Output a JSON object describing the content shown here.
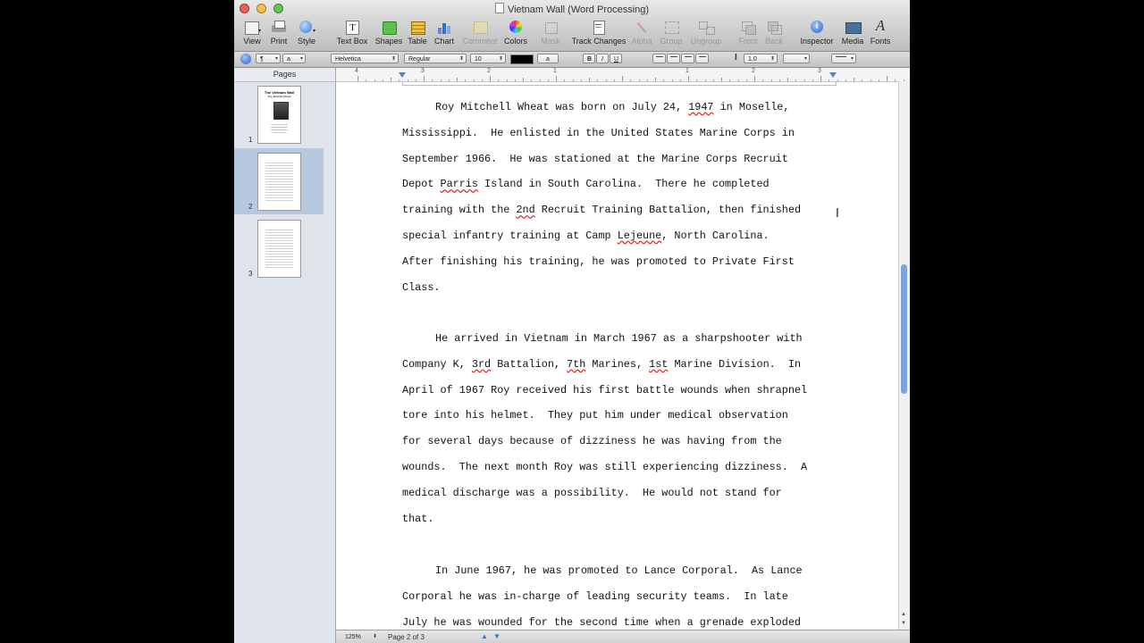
{
  "window": {
    "title": "Vietnam Wall (Word Processing)",
    "traffic_lights": [
      "#ec5f5a",
      "#f4be4f",
      "#62c655"
    ]
  },
  "toolbar": {
    "view": "View",
    "print": "Print",
    "style": "Style",
    "text_box": "Text Box",
    "shapes": "Shapes",
    "table": "Table",
    "chart": "Chart",
    "comment": "Comment",
    "colors": "Colors",
    "mask": "Mask",
    "track_changes": "Track Changes",
    "alpha": "Alpha",
    "group": "Group",
    "ungroup": "Ungroup",
    "front": "Front",
    "back": "Back",
    "inspector": "Inspector",
    "media": "Media",
    "fonts": "Fonts"
  },
  "format_bar": {
    "paragraph_style": "¶",
    "char_style": "a",
    "font_family": "Helvetica",
    "font_typeface": "Regular",
    "font_size": "10",
    "text_color": "#000000",
    "highlight_label": "a",
    "bold": "B",
    "italic": "I",
    "underline": "U",
    "line_spacing_icon": "I",
    "line_spacing": "1.0"
  },
  "sidebar": {
    "header": "Pages",
    "thumbnails": [
      {
        "number": "1",
        "title_lines": [
          "The Vietnam Wall",
          "Roy Mitchell Wheat"
        ]
      },
      {
        "number": "2"
      },
      {
        "number": "3"
      }
    ]
  },
  "ruler": {
    "labels": [
      "4",
      "3",
      "2",
      "1",
      "1",
      "2",
      "3"
    ]
  },
  "document": {
    "paragraphs": [
      {
        "lines": [
          [
            {
              "t": "Roy Mitchell Wheat was born on July 24, "
            },
            {
              "t": "1947",
              "sq": true
            },
            {
              "t": " in Moselle,"
            }
          ],
          [
            {
              "t": "Mississippi.  He enlisted in the United States Marine Corps in"
            }
          ],
          [
            {
              "t": "September 1966.  He was stationed at the Marine Corps Recruit"
            }
          ],
          [
            {
              "t": "Depot "
            },
            {
              "t": "Parris",
              "sq": true
            },
            {
              "t": " Island in South Carolina.  There he completed"
            }
          ],
          [
            {
              "t": "training with the "
            },
            {
              "t": "2nd",
              "sq": true
            },
            {
              "t": " Recruit Training Battalion, then finished"
            }
          ],
          [
            {
              "t": "special infantry training at Camp "
            },
            {
              "t": "Lejeune",
              "sq": true
            },
            {
              "t": ", North Carolina."
            }
          ],
          [
            {
              "t": "After finishing his training, he was promoted to Private First"
            }
          ],
          [
            {
              "t": "Class."
            }
          ]
        ]
      },
      {
        "lines": [
          [
            {
              "t": "He arrived in Vietnam in March 1967 as a sharpshooter with"
            }
          ],
          [
            {
              "t": "Company K, "
            },
            {
              "t": "3rd",
              "sq": true
            },
            {
              "t": " Battalion, "
            },
            {
              "t": "7th",
              "sq": true
            },
            {
              "t": " Marines, "
            },
            {
              "t": "1st",
              "sq": true
            },
            {
              "t": " Marine Division.  In"
            }
          ],
          [
            {
              "t": "April of 1967 Roy received his first battle wounds when shrapnel"
            }
          ],
          [
            {
              "t": "tore into his helmet.  They put him under medical observation"
            }
          ],
          [
            {
              "t": "for several days because of dizziness he was having from the"
            }
          ],
          [
            {
              "t": "wounds.  The next month Roy was still experiencing dizziness.  A"
            }
          ],
          [
            {
              "t": "medical discharge was a possibility.  He would not stand for"
            }
          ],
          [
            {
              "t": "that."
            }
          ]
        ]
      },
      {
        "lines": [
          [
            {
              "t": "In June 1967, he was promoted to Lance Corporal.  As Lance"
            }
          ],
          [
            {
              "t": "Corporal he was in-charge of leading security teams.  In late"
            }
          ],
          [
            {
              "t": "July he was wounded for the second time when a grenade exploded"
            }
          ]
        ]
      }
    ]
  },
  "status_bar": {
    "zoom": "125%",
    "page_indicator": "Page 2 of 3"
  }
}
